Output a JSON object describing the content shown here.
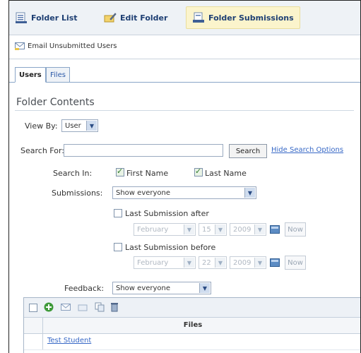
{
  "top_nav": {
    "folder_list": "Folder List",
    "edit_folder": "Edit Folder",
    "folder_submissions": "Folder Submissions"
  },
  "sub_nav": {
    "email_unsubmitted": "Email Unsubmitted Users"
  },
  "tabs": {
    "users": "Users",
    "files": "Files"
  },
  "section_title": "Folder Contents",
  "view_by": {
    "label": "View By:",
    "value": "User"
  },
  "search": {
    "label": "Search For:",
    "value": "",
    "button": "Search",
    "hide_options_link": "Hide Search Options"
  },
  "search_in": {
    "label": "Search In:",
    "first_name": "First Name",
    "last_name": "Last Name"
  },
  "submissions": {
    "label": "Submissions:",
    "value": "Show everyone"
  },
  "last_after": {
    "label": "Last Submission after",
    "month": "February",
    "day": "15",
    "year": "2009",
    "now": "Now"
  },
  "last_before": {
    "label": "Last Submission before",
    "month": "February",
    "day": "22",
    "year": "2009",
    "now": "Now"
  },
  "feedback": {
    "label": "Feedback:",
    "value": "Show everyone"
  },
  "table": {
    "column_files": "Files",
    "rows": [
      {
        "user": "Test Student"
      }
    ]
  },
  "colors": {
    "accent": "#1e3f73",
    "link": "#3768c6",
    "active_tab_bg": "#fbf4cc"
  }
}
